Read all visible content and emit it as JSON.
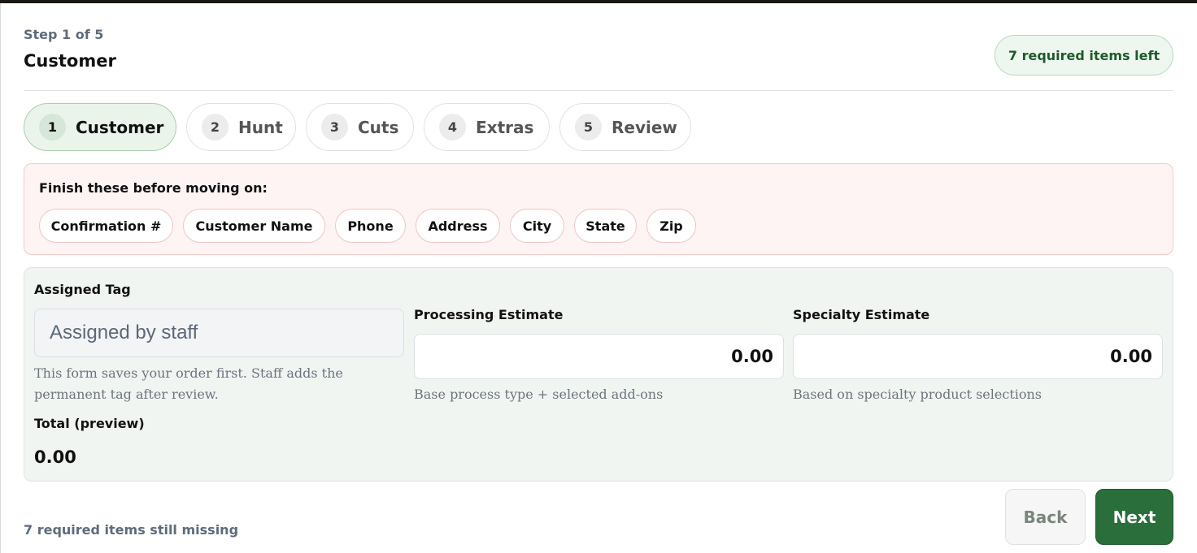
{
  "header": {
    "step_label": "Step 1 of 5",
    "title": "Customer",
    "required_badge": "7 required items left"
  },
  "tabs": [
    {
      "num": "1",
      "label": "Customer",
      "active": true
    },
    {
      "num": "2",
      "label": "Hunt",
      "active": false
    },
    {
      "num": "3",
      "label": "Cuts",
      "active": false
    },
    {
      "num": "4",
      "label": "Extras",
      "active": false
    },
    {
      "num": "5",
      "label": "Review",
      "active": false
    }
  ],
  "alert": {
    "title": "Finish these before moving on:",
    "chips": [
      "Confirmation #",
      "Customer Name",
      "Phone",
      "Address",
      "City",
      "State",
      "Zip"
    ]
  },
  "panel": {
    "assigned_tag": {
      "label": "Assigned Tag",
      "placeholder": "Assigned by staff",
      "help": "This form saves your order first. Staff adds the permanent tag after review."
    },
    "processing": {
      "label": "Processing Estimate",
      "value": "0.00",
      "help": "Base process type + selected add-ons"
    },
    "specialty": {
      "label": "Specialty Estimate",
      "value": "0.00",
      "help": "Based on specialty product selections"
    },
    "total": {
      "label": "Total (preview)",
      "value": "0.00"
    }
  },
  "footer": {
    "missing_text": "7 required items still missing",
    "back_label": "Back",
    "next_label": "Next"
  },
  "colors": {
    "accent_green": "#2a6e3c",
    "alert_bg": "#fff4f4",
    "panel_bg": "#f1f5f2"
  }
}
